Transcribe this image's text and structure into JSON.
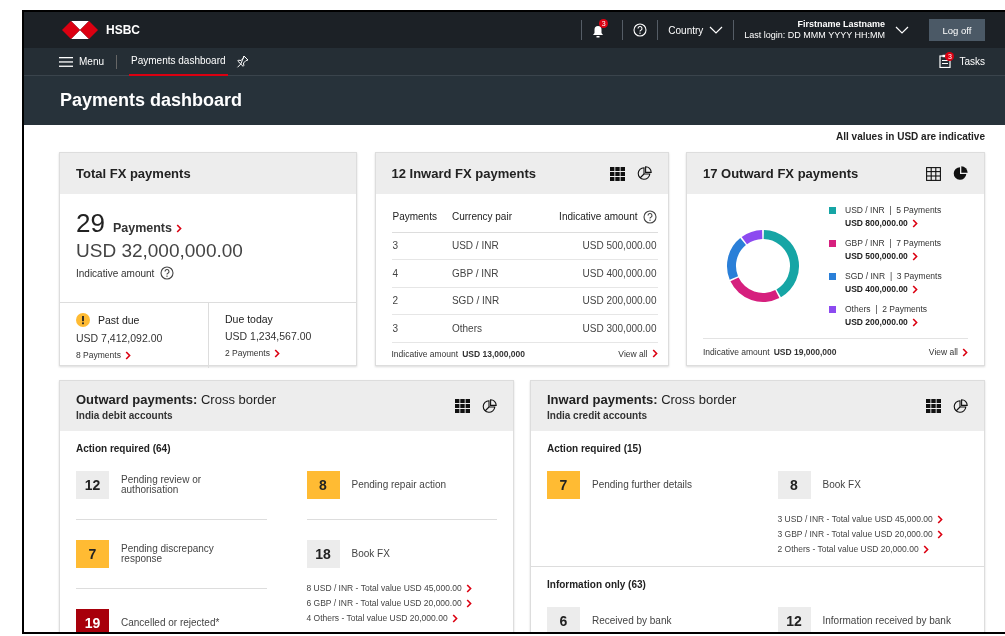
{
  "header": {
    "brand": "HSBC",
    "notifications_badge": "3",
    "country": "Country",
    "user_name": "Firstname Lastname",
    "last_login": "Last login: DD MMM YYYY HH:MM",
    "logoff": "Log off"
  },
  "nav": {
    "menu": "Menu",
    "tabs": [
      {
        "label": "Payments dashboard",
        "selected": true
      }
    ],
    "tasks": "Tasks",
    "tasks_badge": "3"
  },
  "page_title": "Payments dashboard",
  "note": "All values in USD are indicative",
  "total_card": {
    "title": "Total FX payments",
    "count": "29",
    "count_label": "Payments",
    "amount": "USD 32,000,000.00",
    "amount_label": "Indicative amount",
    "splits": [
      {
        "kind": "warning",
        "label": "Past due",
        "amount": "USD 7,412,092.00",
        "link": "8 Payments"
      },
      {
        "kind": "plain",
        "label": "Due today",
        "amount": "USD 1,234,567.00",
        "link": "2 Payments"
      }
    ]
  },
  "inward_fx": {
    "title": "12 Inward FX payments",
    "view": [
      {
        "kind": "table",
        "selected": true
      },
      {
        "kind": "chart",
        "selected": false
      }
    ],
    "columns": [
      "Payments",
      "Currency pair",
      "Indicative amount"
    ],
    "rows": [
      [
        "3",
        "USD / INR",
        "USD 500,000.00"
      ],
      [
        "4",
        "GBP / INR",
        "USD 400,000.00"
      ],
      [
        "2",
        "SGD / INR",
        "USD 200,000.00"
      ],
      [
        "3",
        "Others",
        "USD 300,000.00"
      ]
    ],
    "total_label": "Indicative amount",
    "total": "USD 13,000,000",
    "view_all": "View all"
  },
  "outward_fx": {
    "title": "17 Outward FX payments",
    "view": [
      {
        "kind": "table",
        "selected": false
      },
      {
        "kind": "chart",
        "selected": true
      }
    ],
    "legend": [
      {
        "payments": "|  5 Payments",
        "amount": "USD 800,000.00",
        "color": "#16a5a5"
      },
      {
        "payments": "|  7 Payments",
        "amount": "USD 500,000.00",
        "color": "#d6207e"
      },
      {
        "payments": "|  3 Payments",
        "amount": "USD 400,000.00",
        "color": "#2a7fd8"
      },
      {
        "payments": "|  2 Payments",
        "amount": "USD 200,000.00",
        "color": "#8c4af0"
      }
    ],
    "chart_data": {
      "type": "donut",
      "categories": [
        "USD / INR",
        "GBP / INR",
        "SGD / INR",
        "Others"
      ],
      "series": [
        {
          "values": [
            42.1,
            26.3,
            21.1,
            10.5
          ]
        }
      ]
    },
    "total_label": "Indicative amount",
    "total": "USD 19,000,000",
    "view_all": "View all"
  },
  "status_cards": [
    {
      "title": "**Outward payments:** Cross border",
      "subtitle": "India debit accounts",
      "view": [
        {
          "kind": "table",
          "selected": true
        },
        {
          "kind": "chart",
          "selected": false
        }
      ],
      "sections": [
        {
          "title": "Action required (64)",
          "items": [
            {
              "count": "12",
              "label": "Pending review or authorisation",
              "color": "#ececec"
            },
            {
              "count": "8",
              "label": "Pending repair action",
              "color": "#ffbb33"
            },
            {
              "count": "7",
              "label": "Pending discrepancy response",
              "color": "#ffbb33"
            },
            {
              "count": "18",
              "label": "Book FX",
              "color": "#ececec",
              "links": [
                "8 USD / INR - Total value USD 45,000.00",
                "6 GBP / INR - Total value USD 20,000.00",
                "4 Others - Total value USD 20,000.00"
              ]
            },
            {
              "count": "19",
              "label": "Cancelled or rejected*",
              "color": "#a8000b"
            }
          ]
        }
      ]
    },
    {
      "title": "**Inward payments:** Cross border",
      "subtitle": "India credit accounts",
      "view": [
        {
          "kind": "table",
          "selected": true
        },
        {
          "kind": "chart",
          "selected": false
        }
      ],
      "sections": [
        {
          "title": "Action required (15)",
          "items": [
            {
              "count": "7",
              "label": "Pending further details",
              "color": "#ffbb33"
            },
            {
              "count": "8",
              "label": "Book FX",
              "color": "#ececec",
              "links": [
                "3 USD / INR - Total value USD 45,000.00",
                "3 GBP / INR - Total value USD 20,000.00",
                "2 Others - Total value USD 20,000.00"
              ]
            }
          ]
        },
        {
          "title": "Information only (63)",
          "items": [
            {
              "count": "6",
              "label": "Received by bank",
              "color": "#ececec"
            },
            {
              "count": "12",
              "label": "Information received by bank",
              "color": "#ececec"
            }
          ]
        }
      ]
    }
  ]
}
